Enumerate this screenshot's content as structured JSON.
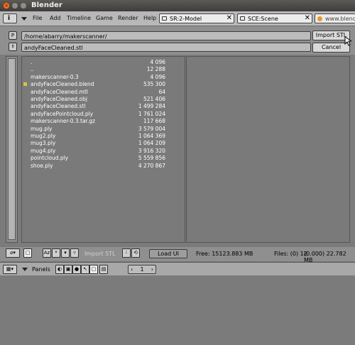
{
  "window": {
    "title": "Blender"
  },
  "menubar": {
    "menus": [
      "File",
      "Add",
      "Timeline",
      "Game",
      "Render",
      "Help"
    ],
    "screen_field": "SR:2-Model",
    "scene_field": "SCE:Scene",
    "url_text": "www.blende"
  },
  "filebrowser": {
    "path_button": "P",
    "directory": "/home/abarry/makerscanner/",
    "filename": "andyFaceCleaned.stl",
    "import_button": "Import STL",
    "cancel_button": "Cancel",
    "files": [
      {
        "name": ".",
        "size": "4 096",
        "selected": false
      },
      {
        "name": "..",
        "size": "12 288",
        "selected": false
      },
      {
        "name": "makerscanner-0.3",
        "size": "4 096",
        "selected": false
      },
      {
        "name": "andyFaceCleaned.blend",
        "size": "535 300",
        "selected": true
      },
      {
        "name": "andyFaceCleaned.mtl",
        "size": "64",
        "selected": false
      },
      {
        "name": "andyFaceCleaned.obj",
        "size": "521 406",
        "selected": false
      },
      {
        "name": "andyFaceCleaned.stl",
        "size": "1 499 284",
        "selected": false
      },
      {
        "name": "andyFacePointcloud.ply",
        "size": "1 761 024",
        "selected": false
      },
      {
        "name": "makerscanner-0.3.tar.gz",
        "size": "117 668",
        "selected": false
      },
      {
        "name": "mug.ply",
        "size": "3 579 004",
        "selected": false
      },
      {
        "name": "mug2.ply",
        "size": "1 064 369",
        "selected": false
      },
      {
        "name": "mug3.ply",
        "size": "1 064 209",
        "selected": false
      },
      {
        "name": "mug4.ply",
        "size": "3 916 320",
        "selected": false
      },
      {
        "name": "pointcloud.ply",
        "size": "5 559 856",
        "selected": false
      },
      {
        "name": "shoe.ply",
        "size": "4 270 867",
        "selected": false
      }
    ],
    "footer": {
      "sort_alpha": "Az",
      "mode_label": "Import STL",
      "load_ui": "Load UI",
      "free": "Free: 15123.883 MB",
      "files": "Files: (0) 12",
      "total": "(0.000) 22.782 MB"
    }
  },
  "panels": {
    "label": "Panels",
    "page_number": "1"
  }
}
